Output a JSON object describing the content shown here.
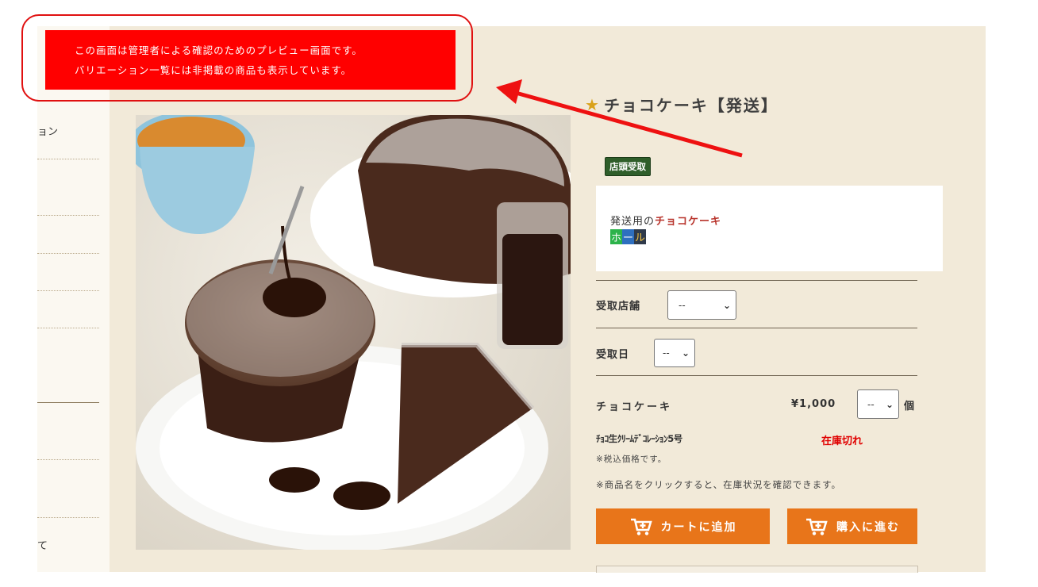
{
  "preview_notice": {
    "line1": "この画面は管理者による確認のためのプレビュー画面です。",
    "line2": "バリエーション一覧には非掲載の商品も表示しています。",
    "banner_color": "#ff0000"
  },
  "sidebar": {
    "items": [
      {
        "label": "ョン"
      },
      {
        "label": "て"
      }
    ]
  },
  "product": {
    "title": "チョコケーキ【発送】",
    "title_icon": "star-icon",
    "image_alt": "chocolate cake",
    "badge": "店頭受取",
    "description": {
      "prefix": "発送用の",
      "highlight": "チョコケーキ",
      "tag_chars": [
        "ホ",
        "ー",
        "ル"
      ],
      "tag_colors": [
        "#2cb34a",
        "#2e6fbf",
        "#2f3a4a"
      ]
    }
  },
  "form": {
    "store_label": "受取店舗",
    "store_value": "--",
    "date_label": "受取日",
    "date_value": "--"
  },
  "line_item": {
    "name": "チョコケーキ",
    "price": "¥1,000",
    "qty_value": "--",
    "unit": "個"
  },
  "variant": {
    "name": "ﾁｮｺ生ｸﾘｰﾑﾃﾞｺﾚｰｼｮﾝ5号",
    "stock_status": "在庫切れ"
  },
  "notes": {
    "tax": "※税込価格です。",
    "stock_hint": "※商品名をクリックすると、在庫状況を確認できます。"
  },
  "buttons": {
    "add_to_cart": "カートに追加",
    "checkout": "購入に進む",
    "color": "#e8751a"
  }
}
